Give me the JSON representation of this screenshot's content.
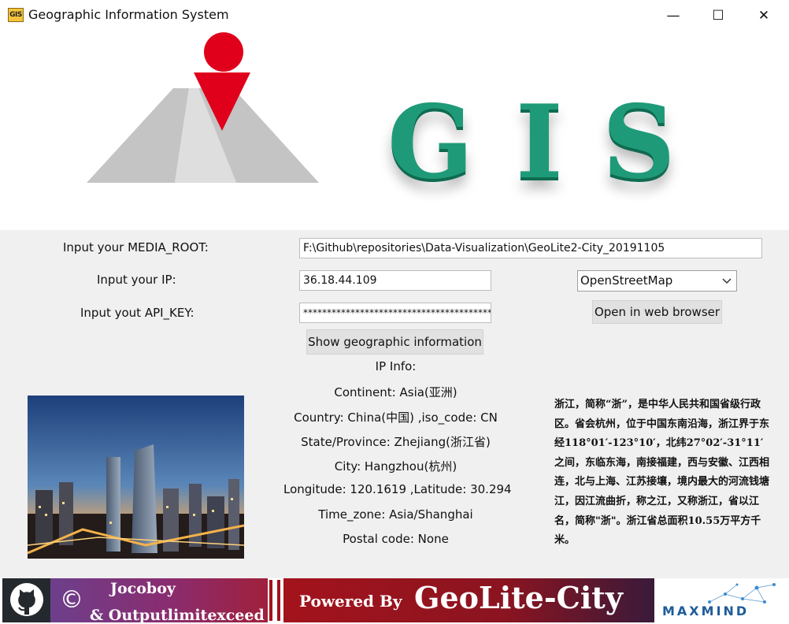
{
  "window": {
    "title": "Geographic Information System",
    "app_icon_text": "GIS",
    "minimize_glyph": "—",
    "maximize_glyph": "☐",
    "close_glyph": "✕"
  },
  "banner": {
    "logo_letters": [
      "G",
      "I",
      "S"
    ]
  },
  "form": {
    "media_root_label": "Input your MEDIA_ROOT:",
    "media_root_value": "F:\\Github\\repositories\\Data-Visualization\\GeoLite2-City_20191105",
    "ip_label": "Input your IP:",
    "ip_value": "36.18.44.109",
    "api_key_label": "Input yout API_KEY:",
    "api_key_value": "********************************************",
    "map_provider_selected": "OpenStreetMap",
    "open_browser_label": "Open in web browser",
    "show_info_label": "Show geographic information"
  },
  "ip_info": {
    "heading": "IP Info:",
    "continent": "Continent: Asia(亚洲)",
    "country": "Country: China(中国) ,iso_code: CN",
    "state": "State/Province: Zhejiang(浙江省)",
    "city": "City: Hangzhou(杭州)",
    "coords": "Longitude: 120.1619 ,Latitude: 30.294",
    "timezone": "Time_zone: Asia/Shanghai",
    "postal": "Postal code: None"
  },
  "description": "浙江，简称“浙”，是中华人民共和国省级行政区。省会杭州，位于中国东南沿海，浙江界于东经118°01′-123°10′，北纬27°02′-31°11′之间，东临东海，南接福建，西与安徽、江西相连，北与上海、江苏接壤，境内最大的河流钱塘江，因江流曲折，称之江，又称浙江，省以江名，简称\"浙\"。浙江省总面积10.55万平方千米。",
  "footer": {
    "copyright_symbol": "©",
    "author_line1": "Jocoboy",
    "author_line2": "& Outputlimitexceed",
    "powered_by": "Powered By",
    "product": "GeoLite-City",
    "maxmind": "MAXMIND"
  },
  "colors": {
    "gis_letters": "#1f9a78",
    "marker_red": "#e0001b",
    "road_gray": "#c4c4c4",
    "panel_bg": "#f0f0f0",
    "footer_red": "#a3131c"
  },
  "icons": {
    "logo": "road-map-marker-icon",
    "github": "github-octocat-icon",
    "dropdown": "chevron-down-icon",
    "maxmind": "maxmind-network-icon"
  }
}
